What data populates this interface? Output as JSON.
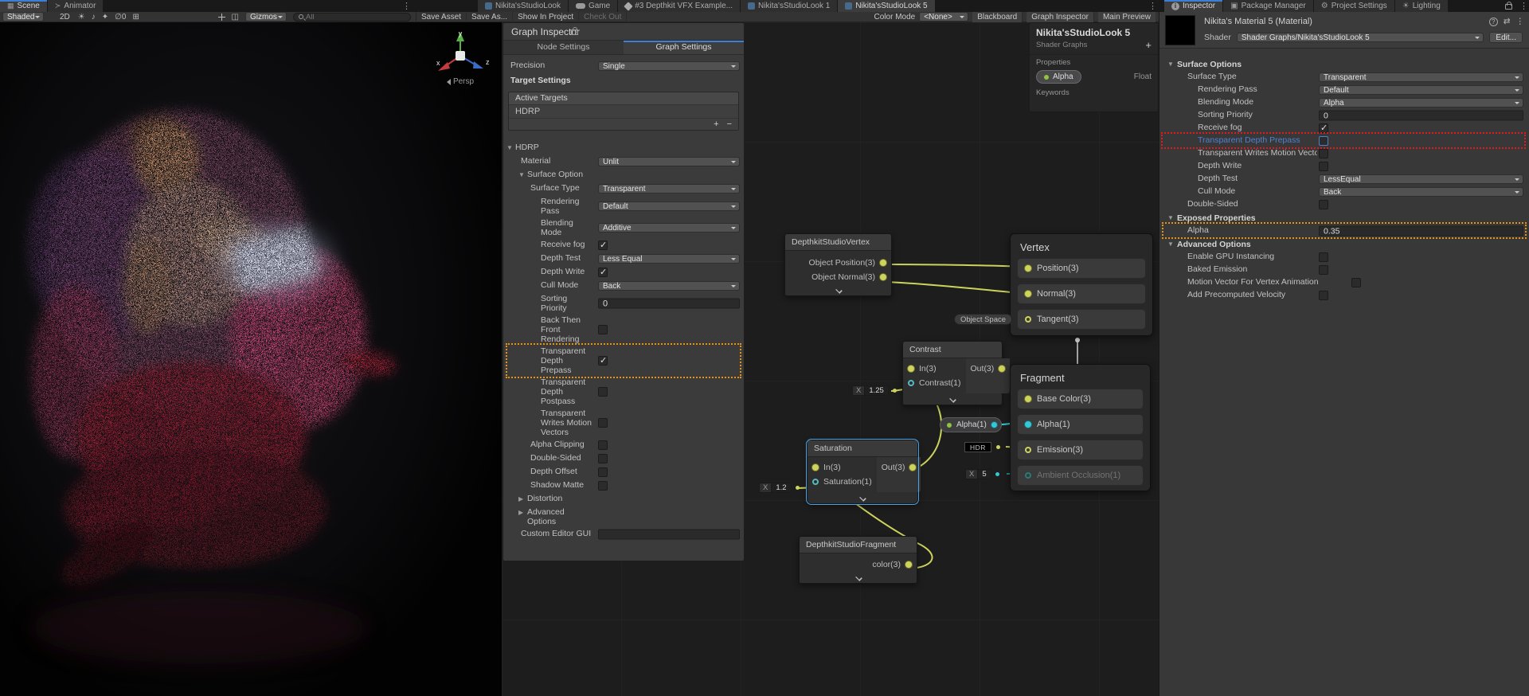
{
  "colors": {
    "accent_blue": "#3C7FD7",
    "selection_blue": "#4AA3E8",
    "highlight_orange": "#E8920E",
    "highlight_red": "#E01B1B",
    "wire_yellow": "#CDD35C",
    "wire_teal": "#35C7D6"
  },
  "icons": {
    "menu": "⋮",
    "light": "☀",
    "audio": "♪",
    "fx": "✦",
    "hidden": "∅",
    "grid": "⊞",
    "camera": "◫",
    "preset": "⇄",
    "help": "?",
    "info": "i",
    "package": "▣",
    "settings": "⚙",
    "lighting": "☀",
    "scene": "▦",
    "animator": "≻",
    "plus": "+",
    "minus": "−"
  },
  "window": {
    "left_tabs": [
      {
        "label": "Scene",
        "active": true,
        "icon": "scene-icon"
      },
      {
        "label": "Animator",
        "active": false,
        "icon": "animator-icon"
      }
    ],
    "graph_tabs": [
      {
        "label": "Nikita'sStudioLook",
        "active": false,
        "icon": "shadergraph-icon"
      },
      {
        "label": "Game",
        "active": false,
        "icon": "game-icon"
      },
      {
        "label": "#3 Depthkit VFX Example...",
        "active": false,
        "icon": "unity-icon"
      },
      {
        "label": "Nikita'sStudioLook 1",
        "active": false,
        "icon": "shadergraph-icon"
      },
      {
        "label": "Nikita'sStudioLook 5",
        "active": true,
        "icon": "shadergraph-icon"
      }
    ],
    "right_tabs": [
      {
        "label": "Inspector",
        "active": true,
        "icon": "info-icon"
      },
      {
        "label": "Package Manager",
        "active": false,
        "icon": "package-icon"
      },
      {
        "label": "Project Settings",
        "active": false,
        "icon": "settings-icon"
      },
      {
        "label": "Lighting",
        "active": false,
        "icon": "light-icon"
      }
    ]
  },
  "scene_toolbar": {
    "shading": "Shaded",
    "two_d": "2D",
    "hidden_count": "0",
    "gizmos": "Gizmos",
    "search_placeholder": "All",
    "persp": "Persp",
    "axis_x": "x",
    "axis_y": "y",
    "axis_z": "z"
  },
  "graph_toolbar": {
    "save_asset": "Save Asset",
    "save_as": "Save As...",
    "show_in_project": "Show In Project",
    "check_out": "Check Out",
    "color_mode_label": "Color Mode",
    "color_mode_value": "<None>",
    "blackboard": "Blackboard",
    "graph_inspector": "Graph Inspector",
    "main_preview": "Main Preview"
  },
  "graph_inspector": {
    "title": "Graph Inspector",
    "tabs": [
      {
        "label": "Node Settings",
        "active": false
      },
      {
        "label": "Graph Settings",
        "active": true
      }
    ],
    "precision_label": "Precision",
    "precision_value": "Single",
    "target_settings_label": "Target Settings",
    "active_targets_label": "Active Targets",
    "targets": [
      "HDRP"
    ],
    "rows": [
      {
        "t": "fold_open",
        "label": "HDRP",
        "ind": 15
      },
      {
        "t": "dropdown",
        "label": "Material",
        "value": "Unlit",
        "ind": 22
      },
      {
        "t": "fold_open",
        "label": "Surface Option",
        "ind": 30
      },
      {
        "t": "dropdown",
        "label": "Surface Type",
        "value": "Transparent",
        "ind": 34
      },
      {
        "t": "dropdown",
        "label": "Rendering Pass",
        "value": "Default",
        "ind": 47
      },
      {
        "t": "dropdown",
        "label": "Blending Mode",
        "value": "Additive",
        "ind": 47
      },
      {
        "t": "check",
        "label": "Receive fog",
        "checked": true,
        "ind": 47
      },
      {
        "t": "dropdown",
        "label": "Depth Test",
        "value": "Less Equal",
        "ind": 47
      },
      {
        "t": "check",
        "label": "Depth Write",
        "checked": true,
        "ind": 47
      },
      {
        "t": "dropdown",
        "label": "Cull Mode",
        "value": "Back",
        "ind": 47
      },
      {
        "t": "numfield",
        "label": "Sorting Priority",
        "value": "0",
        "ind": 47
      },
      {
        "t": "check",
        "label": "Back Then Front Rendering",
        "checked": false,
        "ind": 47
      },
      {
        "t": "check",
        "label": "Transparent Depth Prepass",
        "checked": true,
        "ind": 47,
        "highlight": "orange"
      },
      {
        "t": "check",
        "label": "Transparent Depth Postpass",
        "checked": false,
        "ind": 47
      },
      {
        "t": "check",
        "label": "Transparent Writes Motion Vectors",
        "checked": false,
        "ind": 47
      },
      {
        "t": "check",
        "label": "Alpha Clipping",
        "checked": false,
        "ind": 34
      },
      {
        "t": "check",
        "label": "Double-Sided",
        "checked": false,
        "ind": 34
      },
      {
        "t": "check",
        "label": "Depth Offset",
        "checked": false,
        "ind": 34
      },
      {
        "t": "check",
        "label": "Shadow Matte",
        "checked": false,
        "ind": 34
      },
      {
        "t": "fold_closed",
        "label": "Distortion",
        "ind": 30
      },
      {
        "t": "fold_closed",
        "label": "Advanced Options",
        "ind": 30
      },
      {
        "t": "textfield",
        "label": "Custom Editor GUI",
        "value": "",
        "ind": 22
      }
    ]
  },
  "blackboard": {
    "title": "Nikita'sStudioLook 5",
    "subtitle": "Shader Graphs",
    "add_button": "+",
    "properties_label": "Properties",
    "keywords_label": "Keywords",
    "property": {
      "name": "Alpha",
      "type": "Float"
    }
  },
  "nodes": {
    "dk_vertex": {
      "title": "DepthkitStudioVertex",
      "outputs": [
        "Object Position(3)",
        "Object Normal(3)"
      ]
    },
    "vertex": {
      "title": "Vertex",
      "slots": [
        "Position(3)",
        "Normal(3)",
        "Tangent(3)"
      ],
      "space_badge": "Object Space"
    },
    "contrast": {
      "title": "Contrast",
      "input": "In(3)",
      "param": "Contrast(1)",
      "output": "Out(3)",
      "field_prefix": "X",
      "field_value": "1.25"
    },
    "fragment": {
      "title": "Fragment",
      "slots": [
        "Base Color(3)",
        "Alpha(1)",
        "Emission(3)",
        "Ambient Occlusion(1)"
      ],
      "hdr_label": "HDR",
      "ao_field_prefix": "X",
      "ao_field_value": "5"
    },
    "alpha_property": {
      "label": "Alpha(1)"
    },
    "saturation": {
      "title": "Saturation",
      "input": "In(3)",
      "param": "Saturation(1)",
      "output": "Out(3)",
      "field_prefix": "X",
      "field_value": "1.2"
    },
    "dk_fragment": {
      "title": "DepthkitStudioFragment",
      "output": "color(3)"
    }
  },
  "inspector": {
    "title": "Nikita's Material 5 (Material)",
    "shader_label": "Shader",
    "shader_value": "Shader Graphs/Nikita'sStudioLook 5",
    "edit_button": "Edit...",
    "sections": [
      {
        "title": "Surface Options",
        "rows": [
          {
            "t": "dropdown",
            "label": "Surface Type",
            "value": "Transparent",
            "ind": 0
          },
          {
            "t": "dropdown",
            "label": "Rendering Pass",
            "value": "Default",
            "ind": 1
          },
          {
            "t": "dropdown",
            "label": "Blending Mode",
            "value": "Alpha",
            "ind": 1
          },
          {
            "t": "numfield",
            "label": "Sorting Priority",
            "value": "0",
            "ind": 1
          },
          {
            "t": "check",
            "label": "Receive fog",
            "checked": true,
            "ind": 1
          },
          {
            "t": "check",
            "label": "Transparent Depth Prepass",
            "checked": false,
            "ind": 1,
            "highlight": "red",
            "blue": true,
            "focus": true
          },
          {
            "t": "check",
            "label": "Transparent Writes Motion Vectors",
            "checked": false,
            "ind": 1,
            "clip": 150
          },
          {
            "t": "check",
            "label": "Depth Write",
            "checked": false,
            "ind": 1
          },
          {
            "t": "dropdown",
            "label": "Depth Test",
            "value": "LessEqual",
            "ind": 1
          },
          {
            "t": "dropdown",
            "label": "Cull Mode",
            "value": "Back",
            "ind": 1
          },
          {
            "t": "check",
            "label": "Double-Sided",
            "checked": false,
            "ind": 0
          }
        ]
      },
      {
        "title": "Exposed Properties",
        "rows": [
          {
            "t": "numfield",
            "label": "Alpha",
            "value": "0.35",
            "ind": 0,
            "highlight": "orange"
          }
        ]
      },
      {
        "title": "Advanced Options",
        "rows": [
          {
            "t": "check",
            "label": "Enable GPU Instancing",
            "checked": false,
            "ind": 0
          },
          {
            "t": "check",
            "label": "Baked Emission",
            "checked": false,
            "ind": 0
          },
          {
            "t": "check",
            "label": "Motion Vector For Vertex Animation",
            "checked": false,
            "ind": 0,
            "clip": 310,
            "after": true
          },
          {
            "t": "check",
            "label": "Add Precomputed Velocity",
            "checked": false,
            "ind": 0
          }
        ]
      }
    ]
  }
}
